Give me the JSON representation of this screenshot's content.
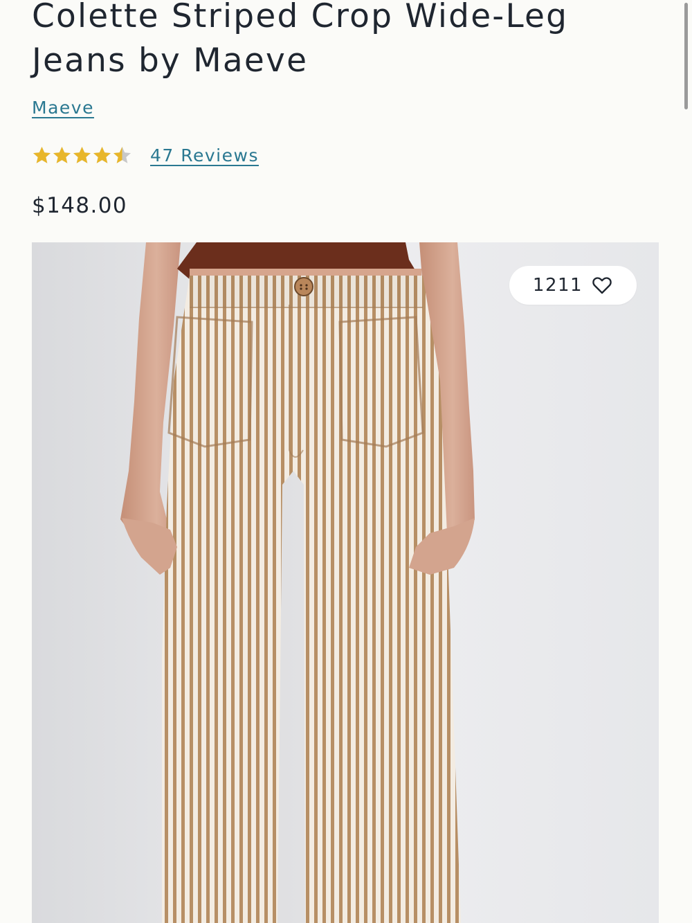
{
  "product": {
    "title": "Colette Striped Crop Wide-Leg Jeans by Maeve",
    "brand": "Maeve",
    "rating": 4.5,
    "rating_max": 5,
    "reviews_label": "47 Reviews",
    "price": "$148.00"
  },
  "gallery": {
    "like_count": "1211",
    "like_icon": "heart-outline-icon"
  },
  "colors": {
    "background": "#fbfbf8",
    "link": "#2a7891",
    "star": "#e8b62a",
    "star_empty": "#c8c8c8",
    "text": "#1f2630"
  }
}
